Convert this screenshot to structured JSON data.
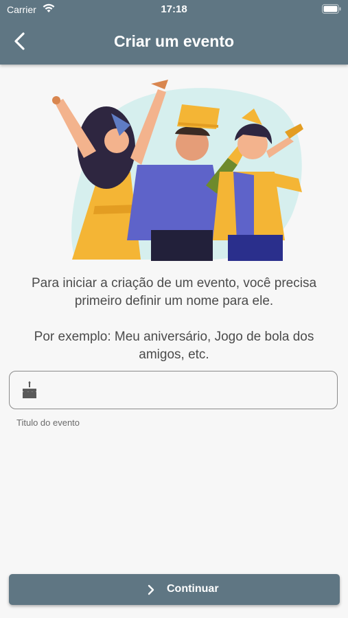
{
  "status_bar": {
    "carrier": "Carrier",
    "time": "17:18"
  },
  "header": {
    "title": "Criar um evento"
  },
  "content": {
    "intro": "Para iniciar a criação de um evento, você precisa primeiro definir um nome para ele.",
    "example": "Por exemplo: Meu aniversário, Jogo de bola dos amigos, etc."
  },
  "event_title_field": {
    "value": "",
    "helper": "Titulo do evento"
  },
  "footer": {
    "continue_label": "Continuar"
  },
  "colors": {
    "primary": "#5f7683",
    "background": "#f7f7f7",
    "text": "#4b4b4b"
  }
}
